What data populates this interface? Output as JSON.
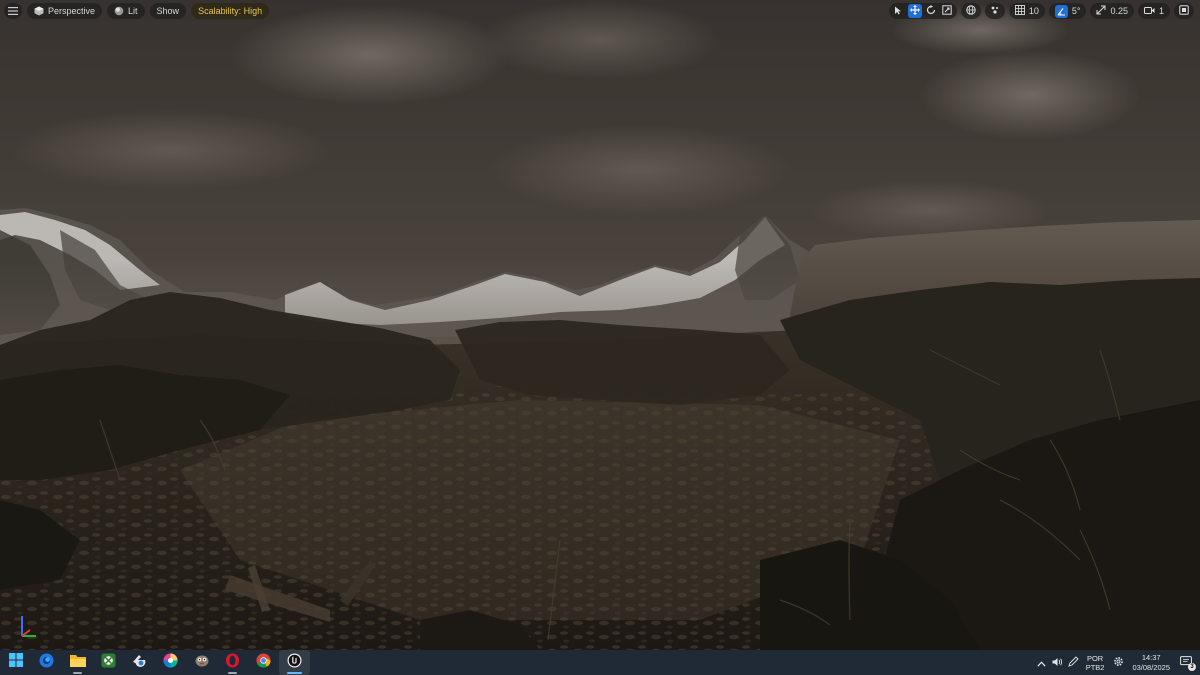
{
  "viewport": {
    "menu_icon": "hamburger-icon",
    "view_mode": {
      "label": "Perspective",
      "icon": "cube-icon"
    },
    "lighting": {
      "label": "Lit",
      "icon": "sphere-icon"
    },
    "show_label": "Show",
    "scalability_label": "Scalability: High",
    "scalability_color": "#e8c64a",
    "right_toolbar": {
      "transform_tools": [
        {
          "name": "select-icon",
          "active": false
        },
        {
          "name": "move-icon",
          "active": true
        },
        {
          "name": "rotate-icon",
          "active": false
        },
        {
          "name": "scale-icon",
          "active": false
        }
      ],
      "coordinate_space_icon": "globe-icon",
      "surface_snap_icon": "surface-snap-icon",
      "grid_snap_value": "10",
      "rotation_snap_value": "5°",
      "scale_snap_value": "0.25",
      "camera_speed_value": "1",
      "maximize_icon": "maximize-icon"
    },
    "accent_color": "#1f6fd6"
  },
  "taskbar": {
    "apps": [
      {
        "name": "windows-start-icon",
        "running": false,
        "active": false
      },
      {
        "name": "edge-browser-icon",
        "running": false,
        "active": false
      },
      {
        "name": "file-explorer-icon",
        "running": true,
        "active": false
      },
      {
        "name": "xbox-app-icon",
        "running": false,
        "active": false
      },
      {
        "name": "blender-app-icon",
        "running": false,
        "active": false
      },
      {
        "name": "color-picker-app-icon",
        "running": false,
        "active": false
      },
      {
        "name": "gimp-app-icon",
        "running": false,
        "active": false
      },
      {
        "name": "opera-browser-icon",
        "running": true,
        "active": false
      },
      {
        "name": "chrome-browser-icon",
        "running": false,
        "active": false
      },
      {
        "name": "unreal-engine-icon",
        "running": true,
        "active": true
      }
    ],
    "tray": {
      "chevron_icon": "chevron-up-icon",
      "volume_icon": "volume-icon",
      "pen_icon": "pen-icon",
      "language_line1": "POR",
      "language_line2": "PTB2",
      "settings_icon": "gear-icon",
      "time": "14:37",
      "date": "03/08/2025",
      "notification_icon": "notification-icon",
      "notification_count": "3"
    },
    "background_color": "#1f2a36"
  }
}
